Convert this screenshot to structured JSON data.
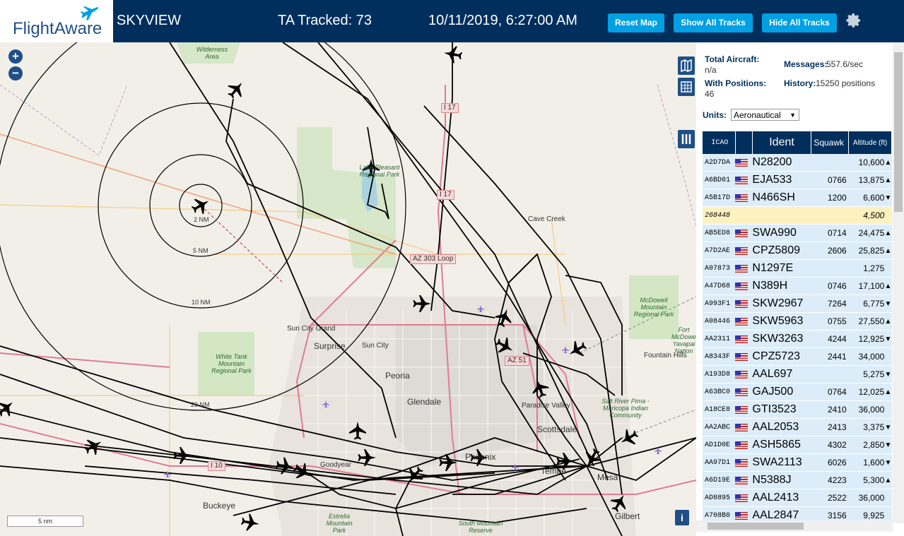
{
  "header": {
    "logo_text": "FlightAware",
    "app_name": "SKYVIEW",
    "tracked": "TA Tracked: 73",
    "datetime": "10/11/2019, 6:27:00 AM",
    "reset_map_label": "Reset Map",
    "show_tracks_label": "Show All Tracks",
    "hide_tracks_label": "Hide All Tracks",
    "settings_icon": "gear-icon"
  },
  "map": {
    "zoom_in": "+",
    "zoom_out": "−",
    "scale_label": "5 nm",
    "info_label": "i",
    "range_rings": [
      "2 NM",
      "5 NM",
      "10 NM",
      "20 NM"
    ],
    "place_labels": [
      "Cave Creek",
      "Sun City Grand",
      "Surprise",
      "Sun City",
      "Peoria",
      "Glendale",
      "Paradise Valley",
      "Scottsdale",
      "Phoenix",
      "Tempe",
      "Mesa",
      "Gilbert",
      "Goodyear",
      "Buckeye",
      "Fountain Hills",
      "Fort McDowell Yavapai Nation"
    ],
    "park_labels": [
      "Wilderness Area",
      "Lake Pleasant Regional Park",
      "McDowell Mountain Regional Park",
      "White Tank Mountain Regional Park",
      "Salt River Pima - Maricopa Indian Community",
      "Estrella Mountain Park",
      "South Mountain Reserve"
    ],
    "road_labels": [
      "I 17",
      "I 17",
      "AZ 303 Loop",
      "AZ 51",
      "I 10"
    ]
  },
  "stats": {
    "total_label": "Total Aircraft:",
    "total_value": "n/a",
    "messages_label": "Messages:",
    "messages_value": "557.6/sec",
    "positions_label": "With Positions:",
    "positions_value": "46",
    "history_label": "History:",
    "history_value": "15250 positions"
  },
  "units": {
    "label": "Units:",
    "selected": "Aeronautical"
  },
  "table": {
    "headers": [
      "ICAO",
      "",
      "Ident",
      "Squawk",
      "Altitude (ft)"
    ],
    "rows": [
      {
        "icao": "A2D7DA",
        "ident": "N28200",
        "squawk": "",
        "alt": "10,600",
        "trend": "▲",
        "style": "blue"
      },
      {
        "icao": "A6BD01",
        "ident": "EJA533",
        "squawk": "0766",
        "alt": "13,875",
        "trend": "▲",
        "style": "blue"
      },
      {
        "icao": "A5B17D",
        "ident": "N466SH",
        "squawk": "1200",
        "alt": "6,600",
        "trend": "▼",
        "style": "blue"
      },
      {
        "icao": "268448",
        "ident": "",
        "squawk": "",
        "alt": "4,500",
        "trend": "",
        "style": "yellow"
      },
      {
        "icao": "AB5ED8",
        "ident": "SWA990",
        "squawk": "0714",
        "alt": "24,475",
        "trend": "▲",
        "style": "blue"
      },
      {
        "icao": "A7D2AE",
        "ident": "CPZ5809",
        "squawk": "2606",
        "alt": "25,825",
        "trend": "▲",
        "style": "blue"
      },
      {
        "icao": "A07873",
        "ident": "N1297E",
        "squawk": "",
        "alt": "1,275",
        "trend": "",
        "style": "blue"
      },
      {
        "icao": "A47D68",
        "ident": "N389H",
        "squawk": "0746",
        "alt": "17,100",
        "trend": "▲",
        "style": "blue"
      },
      {
        "icao": "A993F1",
        "ident": "SKW2967",
        "squawk": "7264",
        "alt": "6,775",
        "trend": "▼",
        "style": "blue"
      },
      {
        "icao": "A08446",
        "ident": "SKW5963",
        "squawk": "0755",
        "alt": "27,550",
        "trend": "▲",
        "style": "blue"
      },
      {
        "icao": "AA2311",
        "ident": "SKW3263",
        "squawk": "4244",
        "alt": "12,925",
        "trend": "▼",
        "style": "blue"
      },
      {
        "icao": "A8343F",
        "ident": "CPZ5723",
        "squawk": "2441",
        "alt": "34,000",
        "trend": "",
        "style": "blue"
      },
      {
        "icao": "A193D8",
        "ident": "AAL697",
        "squawk": "",
        "alt": "5,275",
        "trend": "▼",
        "style": "blue"
      },
      {
        "icao": "A63BC0",
        "ident": "GAJ500",
        "squawk": "0764",
        "alt": "12,025",
        "trend": "▲",
        "style": "blue"
      },
      {
        "icao": "A18CE8",
        "ident": "GTI3523",
        "squawk": "2410",
        "alt": "36,000",
        "trend": "",
        "style": "blue"
      },
      {
        "icao": "AA2ABC",
        "ident": "AAL2053",
        "squawk": "2413",
        "alt": "3,375",
        "trend": "▼",
        "style": "blue"
      },
      {
        "icao": "AD1D0E",
        "ident": "ASH5865",
        "squawk": "4302",
        "alt": "2,850",
        "trend": "▼",
        "style": "blue"
      },
      {
        "icao": "AA97D1",
        "ident": "SWA2113",
        "squawk": "6026",
        "alt": "1,600",
        "trend": "▼",
        "style": "blue"
      },
      {
        "icao": "A6D19E",
        "ident": "N5388J",
        "squawk": "4223",
        "alt": "5,300",
        "trend": "▲",
        "style": "blue"
      },
      {
        "icao": "AD8895",
        "ident": "AAL2413",
        "squawk": "2522",
        "alt": "36,000",
        "trend": "",
        "style": "blue"
      },
      {
        "icao": "A708B0",
        "ident": "AAL2847",
        "squawk": "3156",
        "alt": "9,925",
        "trend": "",
        "style": "blue"
      }
    ]
  },
  "colors": {
    "header_bg": "#002f5d",
    "button_bg": "#00a0e2",
    "row_blue": "#dcedf9",
    "row_yellow": "#fdf1c0"
  }
}
